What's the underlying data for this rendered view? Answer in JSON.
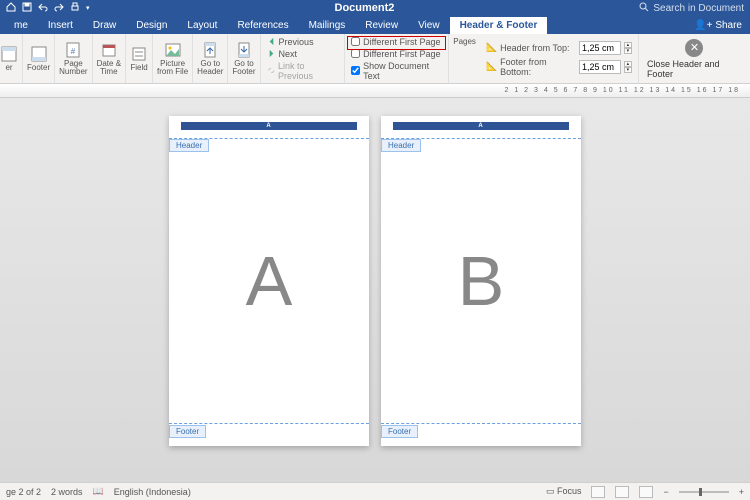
{
  "titlebar": {
    "doc": "Document2",
    "search_placeholder": "Search in Document"
  },
  "tabs": [
    "me",
    "Insert",
    "Draw",
    "Design",
    "Layout",
    "References",
    "Mailings",
    "Review",
    "View",
    "Header & Footer"
  ],
  "active_tab": "Header & Footer",
  "share": "Share",
  "ribbon": {
    "header": "er",
    "footer": "Footer",
    "page_number": "Page\nNumber",
    "date_time": "Date &\nTime",
    "field": "Field",
    "picture": "Picture\nfrom File",
    "goto_header": "Go to\nHeader",
    "goto_footer": "Go to\nFooter",
    "nav": {
      "previous": "Previous",
      "next": "Next",
      "link": "Link to Previous"
    },
    "options": {
      "diff_first": "Different First Page",
      "diff_odd_even": "Different First Page",
      "show_doc": "Show Document Text",
      "pages": "Pages"
    },
    "position": {
      "header_label": "Header from Top:",
      "footer_label": "Footer from Bottom:",
      "header_val": "1,25 cm",
      "footer_val": "1,25 cm"
    },
    "close": "Close Header\nand Footer"
  },
  "ruler_marks": "2  1  2  3  4  5  6  7  8  9  10 11 12 13 14 15 16 17 18",
  "page": {
    "header_tag": "Header",
    "footer_tag": "Footer",
    "hbar_label": "A"
  },
  "pages": [
    {
      "letter": "A"
    },
    {
      "letter": "B"
    }
  ],
  "status": {
    "page": "ge 2 of 2",
    "words": "2 words",
    "lang": "English (Indonesia)",
    "focus": "Focus"
  }
}
